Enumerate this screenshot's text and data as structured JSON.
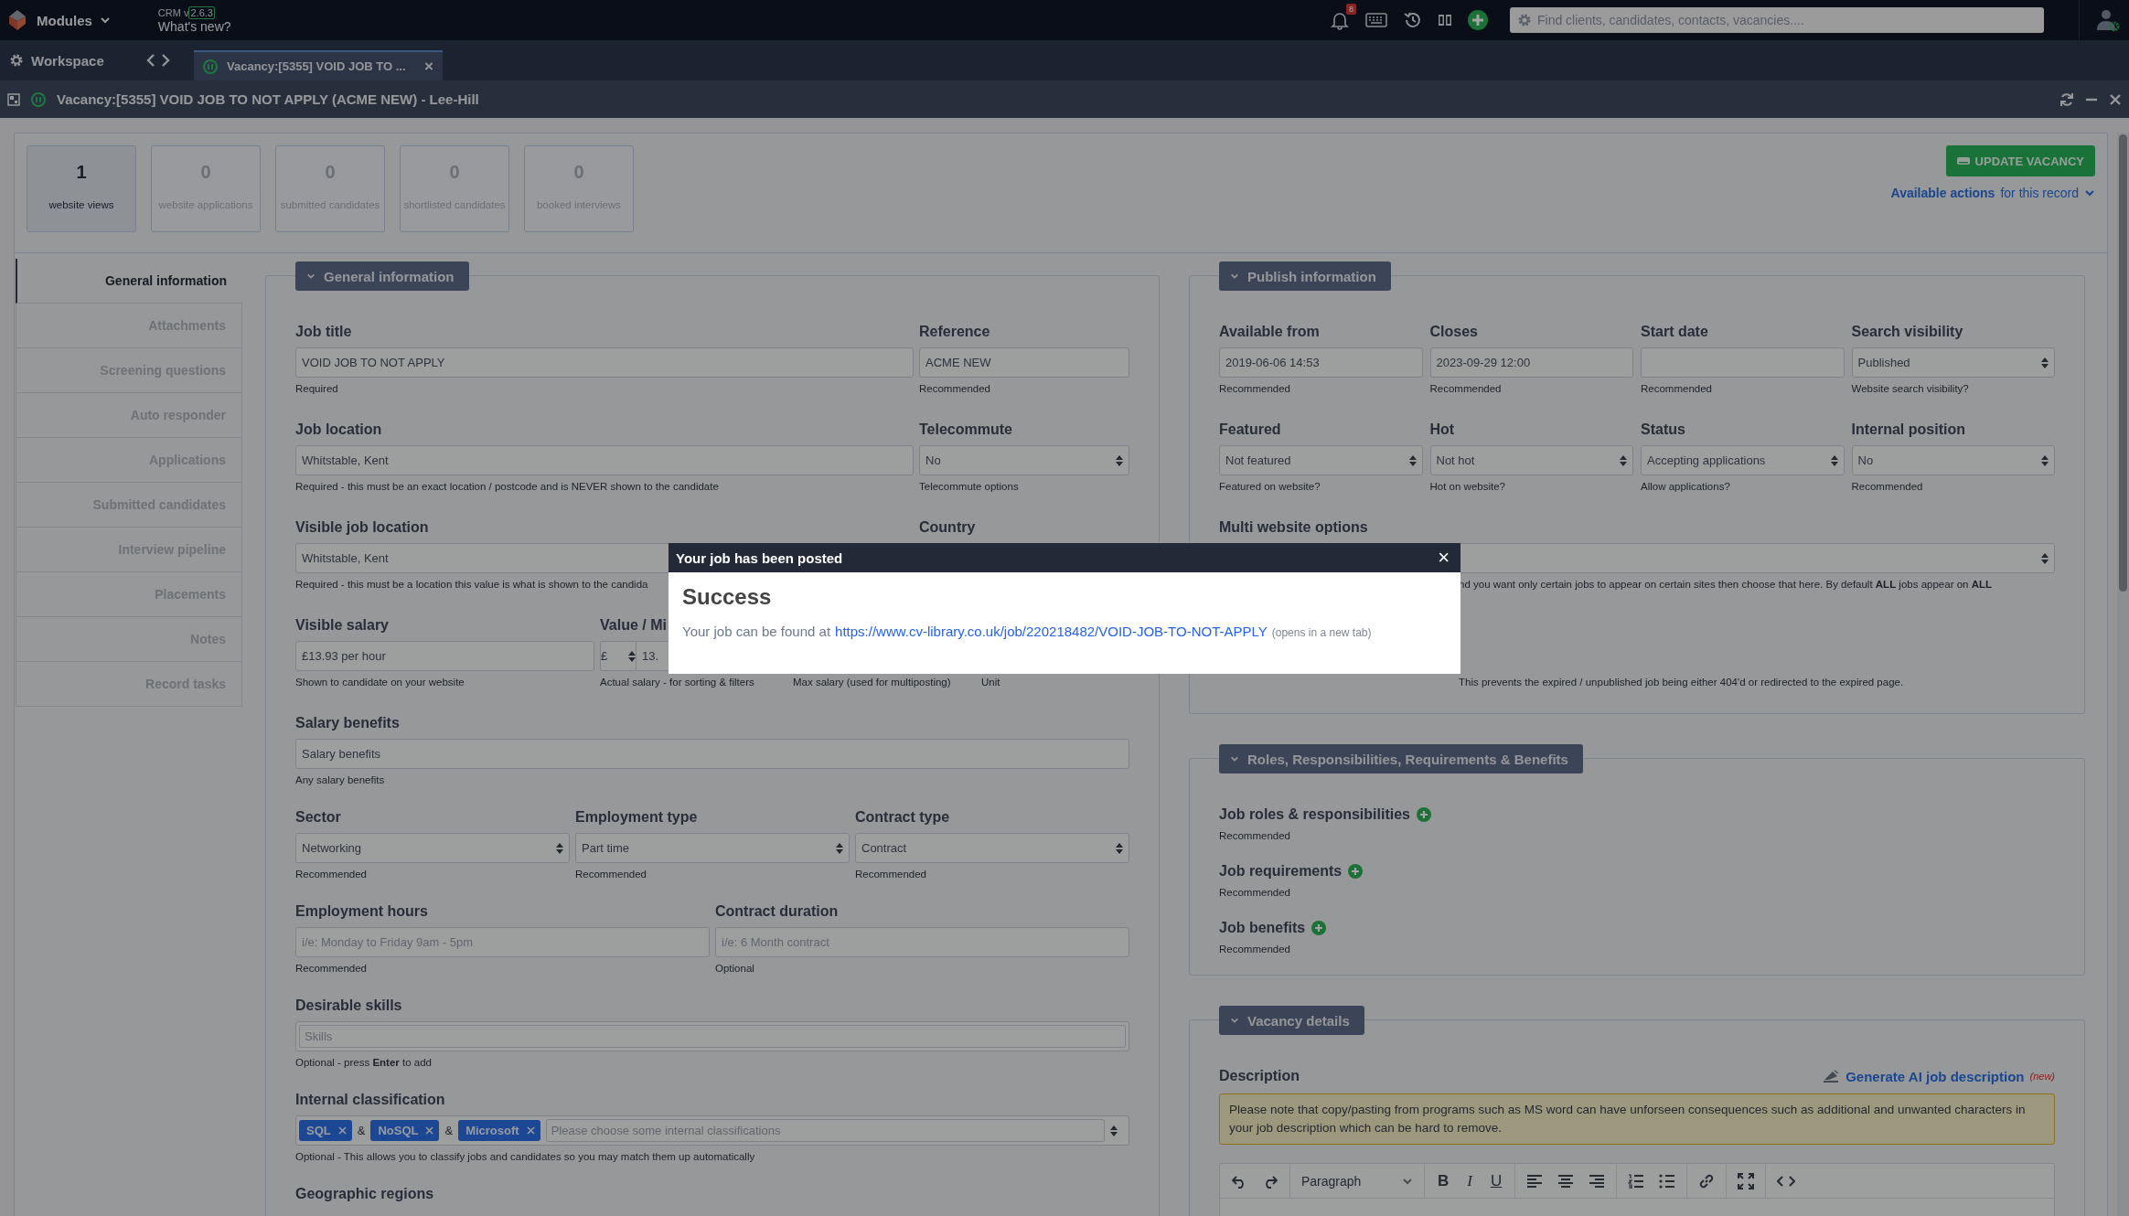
{
  "topbar": {
    "menu": "Modules",
    "version_label": "CRM v",
    "version": "2.6.3",
    "whats_new": "What's new?",
    "notification_count": "8",
    "search": {
      "placeholder": "Find clients, candidates, contacts, vacancies...."
    }
  },
  "workspace": {
    "label": "Workspace",
    "tabs": [
      {
        "label": "Vacancy:[5355] VOID JOB TO ...",
        "selected": true,
        "close": "×"
      }
    ]
  },
  "record": {
    "title": "Vacancy:[5355] VOID JOB TO NOT APPLY (ACME NEW) - Lee-Hill"
  },
  "stats": [
    {
      "value": "1",
      "label": "website views",
      "highlighted": true
    },
    {
      "value": "0",
      "label": "website applications",
      "highlighted": false
    },
    {
      "value": "0",
      "label": "submitted candidates",
      "highlighted": false
    },
    {
      "value": "0",
      "label": "shortlisted candidates",
      "highlighted": false
    },
    {
      "value": "0",
      "label": "booked interviews",
      "highlighted": false
    }
  ],
  "update_button": "UPDATE VACANCY",
  "actions": {
    "link": "Available actions",
    "suffix": "for this record"
  },
  "sidebar": {
    "items": [
      {
        "label": "General information",
        "selected": true
      },
      {
        "label": "Attachments",
        "selected": false
      },
      {
        "label": "Screening questions",
        "selected": false
      },
      {
        "label": "Auto responder",
        "selected": false
      },
      {
        "label": "Applications",
        "selected": false
      },
      {
        "label": "Submitted candidates",
        "selected": false
      },
      {
        "label": "Interview pipeline",
        "selected": false
      },
      {
        "label": "Placements",
        "selected": false
      },
      {
        "label": "Notes",
        "selected": false
      },
      {
        "label": "Record tasks",
        "selected": false
      }
    ]
  },
  "columns": [
    {
      "sections": [
        {
          "kind": "form",
          "title": "General information",
          "rows": [
            {
              "kind": "main-side",
              "fields": [
                {
                  "kind": "text",
                  "label": "Job title",
                  "value": "VOID JOB TO NOT APPLY",
                  "help": "Required"
                },
                {
                  "kind": "text",
                  "label": "Reference",
                  "value": "ACME NEW",
                  "help": "Recommended"
                }
              ]
            },
            {
              "kind": "main-side",
              "fields": [
                {
                  "kind": "text",
                  "label": "Job location",
                  "value": "Whitstable, Kent",
                  "help": "Required - this must be an exact location / postcode and is NEVER shown to the candidate"
                },
                {
                  "kind": "select",
                  "label": "Telecommute",
                  "value": "No",
                  "help": "Telecommute options"
                }
              ]
            },
            {
              "kind": "main-side",
              "fields": [
                {
                  "kind": "text",
                  "label": "Visible job location",
                  "value": "Whitstable, Kent",
                  "help": "Required - this must be a location this value is what is shown to the candida"
                },
                {
                  "kind": "covered",
                  "label": "Country"
                }
              ]
            },
            {
              "kind": "salary",
              "fields": [
                {
                  "kind": "text",
                  "label": "Visible salary",
                  "value": "£13.93 per hour",
                  "help": "Shown to candidate on your website"
                },
                {
                  "kind": "currency",
                  "label": "Value / Mi",
                  "currency": "£",
                  "value": "13.",
                  "help": "Actual salary - for sorting & filters"
                },
                {
                  "kind": "covered",
                  "help": "Max salary (used for multiposting)"
                },
                {
                  "kind": "covered",
                  "help": "Unit"
                }
              ]
            },
            {
              "kind": "full",
              "fields": [
                {
                  "kind": "text",
                  "label": "Salary benefits",
                  "value": "Salary benefits",
                  "help": "Any salary benefits"
                }
              ]
            },
            {
              "kind": "thirds",
              "fields": [
                {
                  "kind": "select",
                  "label": "Sector",
                  "value": "Networking",
                  "help": "Recommended"
                },
                {
                  "kind": "select",
                  "label": "Employment type",
                  "value": "Part time",
                  "help": "Recommended"
                },
                {
                  "kind": "select",
                  "label": "Contract type",
                  "value": "Contract",
                  "help": "Recommended"
                }
              ]
            },
            {
              "kind": "halves",
              "fields": [
                {
                  "kind": "text",
                  "label": "Employment hours",
                  "placeholder": "i/e: Monday to Friday 9am - 5pm",
                  "help": "Recommended"
                },
                {
                  "kind": "text",
                  "label": "Contract duration",
                  "placeholder": "i/e: 6 Month contract",
                  "help": "Optional"
                }
              ]
            },
            {
              "kind": "full",
              "fields": [
                {
                  "kind": "skills",
                  "label": "Desirable skills",
                  "placeholder": "Skills",
                  "help": "Optional - press **Enter** to add"
                }
              ]
            },
            {
              "kind": "full",
              "fields": [
                {
                  "kind": "tags",
                  "label": "Internal classification",
                  "tags": [
                    "SQL",
                    "NoSQL",
                    "Microsoft"
                  ],
                  "separator": "&",
                  "placeholder": "Please choose some internal classifications",
                  "help": "Optional - This allows you to classify jobs and candidates so you may match them up automatically"
                }
              ]
            },
            {
              "kind": "full",
              "fields": [
                {
                  "kind": "covered",
                  "label": "Geographic regions"
                }
              ]
            }
          ]
        }
      ]
    },
    {
      "sections": [
        {
          "kind": "form",
          "title": "Publish information",
          "rows": [
            {
              "kind": "quarters",
              "fields": [
                {
                  "kind": "text",
                  "label": "Available from",
                  "value": "2019-06-06 14:53",
                  "help": "Recommended"
                },
                {
                  "kind": "text",
                  "label": "Closes",
                  "value": "2023-09-29 12:00",
                  "help": "Recommended"
                },
                {
                  "kind": "text",
                  "label": "Start date",
                  "help": "Recommended"
                },
                {
                  "kind": "select",
                  "label": "Search visibility",
                  "value": "Published",
                  "help": "Website search visibility?"
                }
              ]
            },
            {
              "kind": "quarters",
              "fields": [
                {
                  "kind": "select",
                  "label": "Featured",
                  "value": "Not featured",
                  "help": "Featured on website?"
                },
                {
                  "kind": "select",
                  "label": "Hot",
                  "value": "Not hot",
                  "help": "Hot on website?"
                },
                {
                  "kind": "select",
                  "label": "Status",
                  "value": "Accepting applications",
                  "help": "Allow applications?"
                },
                {
                  "kind": "select",
                  "label": "Internal position",
                  "value": "No",
                  "help": "Recommended"
                }
              ]
            },
            {
              "kind": "full",
              "fields": [
                {
                  "kind": "select-tail",
                  "label": "Multi website options",
                  "help": "nd you want only certain jobs to appear on certain sites then choose that here. By default **ALL** jobs appear on **ALL**"
                }
              ]
            },
            {
              "kind": "full",
              "fields": [
                {
                  "kind": "tail",
                  "help": "This prevents the expired / unpublished job being either 404'd or redirected to the expired page."
                }
              ]
            }
          ]
        },
        {
          "kind": "list",
          "title": "Roles, Responsibilities, Requirements & Benefits",
          "items": [
            {
              "label": "Job roles & responsibilities",
              "help": "Recommended"
            },
            {
              "label": "Job requirements",
              "help": "Recommended"
            },
            {
              "label": "Job benefits",
              "help": "Recommended"
            }
          ]
        },
        {
          "kind": "editor",
          "title": "Vacancy details",
          "label": "Description",
          "ai_link": "Generate AI job description",
          "ai_badge": "(new)",
          "notice": "Please note that copy/pasting from programs such as MS word can have unforseen consequences such as additional and unwanted characters in your job description which can be hard to remove.",
          "toolbar": [
            [
              {
                "kind": "undo"
              },
              {
                "kind": "redo"
              }
            ],
            [
              {
                "kind": "block",
                "label": "Paragraph"
              }
            ],
            [
              {
                "kind": "bold",
                "label": "B"
              },
              {
                "kind": "italic",
                "label": "I"
              },
              {
                "kind": "underline",
                "label": "U"
              }
            ],
            [
              {
                "kind": "align-left"
              },
              {
                "kind": "align-center"
              },
              {
                "kind": "align-right"
              }
            ],
            [
              {
                "kind": "ordered-list"
              },
              {
                "kind": "bullet-list"
              }
            ],
            [
              {
                "kind": "link"
              }
            ],
            [
              {
                "kind": "fullscreen"
              }
            ],
            [
              {
                "kind": "code"
              }
            ]
          ]
        }
      ]
    }
  ],
  "modal": {
    "title": "Your job has been posted",
    "close": "×",
    "heading": "Success",
    "text": "Your job can be found at",
    "link": "https://www.cv-library.co.uk/job/220218482/VOID-JOB-TO-NOT-APPLY",
    "note": "(opens in a new tab)"
  }
}
